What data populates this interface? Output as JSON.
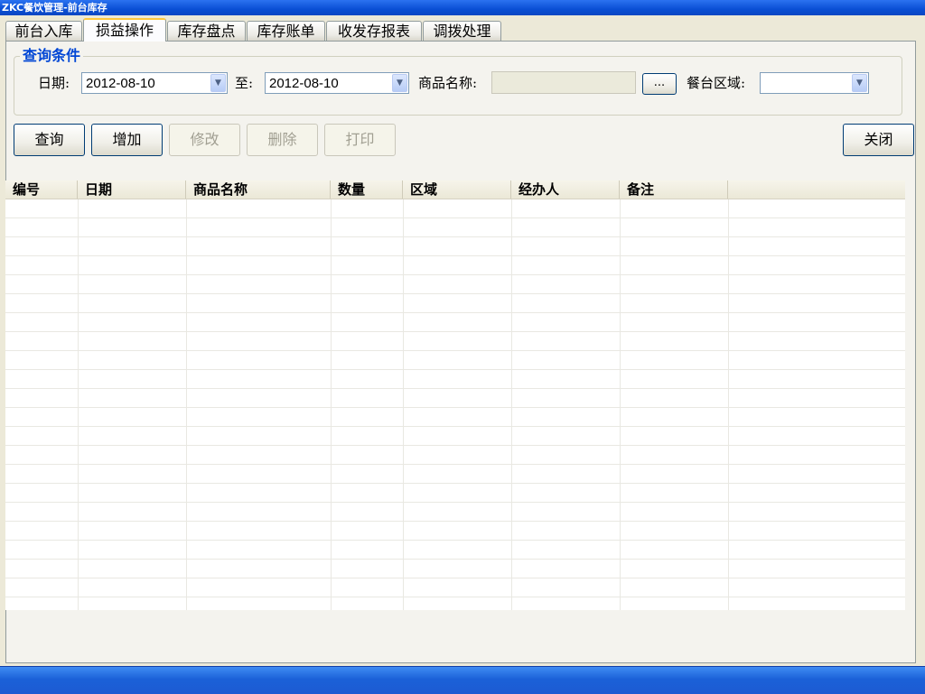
{
  "window": {
    "title": "ZKC餐饮管理-前台库存"
  },
  "tabs": [
    {
      "label": "前台入库",
      "active": false
    },
    {
      "label": "损益操作",
      "active": true
    },
    {
      "label": "库存盘点",
      "active": false
    },
    {
      "label": "库存账单",
      "active": false
    },
    {
      "label": "收发存报表",
      "active": false
    },
    {
      "label": "调拨处理",
      "active": false
    }
  ],
  "query": {
    "legend": "查询条件",
    "date_label": "日期:",
    "date_from": "2012-08-10",
    "to_label": "至:",
    "date_to": "2012-08-10",
    "product_label": "商品名称:",
    "product_value": "",
    "browse_label": "...",
    "area_label": "餐台区域:",
    "area_value": ""
  },
  "toolbar": {
    "query": "查询",
    "add": "增加",
    "edit": "修改",
    "delete": "删除",
    "print": "打印",
    "close": "关闭"
  },
  "table": {
    "columns": [
      "编号",
      "日期",
      "商品名称",
      "数量",
      "区域",
      "经办人",
      "备注"
    ],
    "rows": []
  },
  "colors": {
    "titlebar": "#0a4fd4",
    "active_tab_accent": "#ffc83c",
    "legend_text": "#0046d5",
    "statusbar": "#1b61d8"
  }
}
